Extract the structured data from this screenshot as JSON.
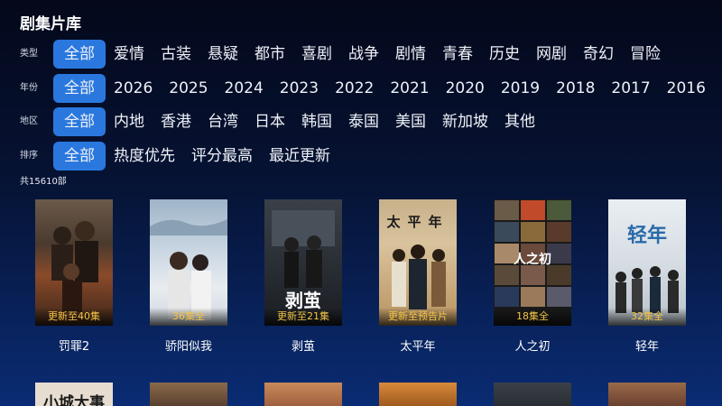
{
  "page": {
    "title": "剧集片库"
  },
  "filters": {
    "type": {
      "label": "类型",
      "options": [
        "全部",
        "爱情",
        "古装",
        "悬疑",
        "都市",
        "喜剧",
        "战争",
        "剧情",
        "青春",
        "历史",
        "网剧",
        "奇幻",
        "冒险"
      ]
    },
    "year": {
      "label": "年份",
      "options": [
        "全部",
        "2026",
        "2025",
        "2024",
        "2023",
        "2022",
        "2021",
        "2020",
        "2019",
        "2018",
        "2017",
        "2016"
      ]
    },
    "region": {
      "label": "地区",
      "options": [
        "全部",
        "内地",
        "香港",
        "台湾",
        "日本",
        "韩国",
        "泰国",
        "美国",
        "新加坡",
        "其他"
      ]
    },
    "sort": {
      "label": "排序",
      "options": [
        "全部",
        "热度优先",
        "评分最高",
        "最近更新"
      ]
    }
  },
  "count_text": "共15610部",
  "shows": [
    {
      "title": "罚罪2",
      "episode": "更新至40集"
    },
    {
      "title": "骄阳似我",
      "episode": "36集全"
    },
    {
      "title": "剥茧",
      "episode": "更新至21集",
      "poster_text": "剥茧"
    },
    {
      "title": "太平年",
      "episode": "更新至预告片",
      "poster_text": "太平年"
    },
    {
      "title": "人之初",
      "episode": "18集全",
      "poster_text": "人之初"
    },
    {
      "title": "轻年",
      "episode": "32集全",
      "poster_text": "轻年"
    }
  ],
  "second_row_poster_texts": [
    "小城大事"
  ],
  "colors": {
    "accent": "#2a78de",
    "episode_text": "#f3c447"
  }
}
